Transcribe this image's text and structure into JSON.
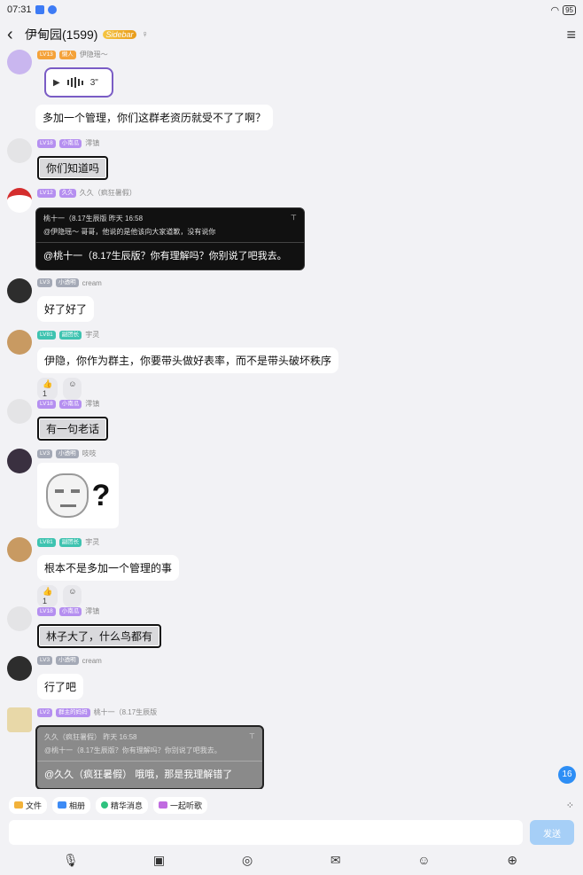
{
  "status": {
    "time": "07:31",
    "battery": "95"
  },
  "nav": {
    "title": "伊甸园(1599)",
    "badge": "Sidebar"
  },
  "messages": {
    "m1": {
      "lv": "LV13",
      "title": "懒人",
      "name": "伊隐瑶～",
      "duration": "3\"",
      "text": "多加一个管理，你们这群老资历就受不了了啊？"
    },
    "m2": {
      "lv": "LV18",
      "title": "小南瓜",
      "name": "澪镇",
      "text": "你们知道吗"
    },
    "m3": {
      "lv": "LV12",
      "title": "久久",
      "name": "久久（疯狂暑假）",
      "quote_head": "桃十一（8.17生辰版 昨天 16:58",
      "quote_text": "@伊隐瑶～ 哥哥，他说的是他该向大家道歉，没有说你",
      "text": "@桃十一（8.17生辰版？你有理解吗？你别说了吧我去。"
    },
    "m4": {
      "lv": "LV3",
      "title": "小透明",
      "name": "cream",
      "text": "好了好了"
    },
    "m5": {
      "lv": "LV81",
      "title": "副团长",
      "name": "宇灵",
      "text": "伊隐，你作为群主，你要带头做好表率，而不是带头破坏秩序",
      "likes": "1"
    },
    "m6": {
      "lv": "LV18",
      "title": "小南瓜",
      "name": "澪镇",
      "text": "有一句老话"
    },
    "m7": {
      "lv": "LV3",
      "title": "小透明",
      "name": "吱吱"
    },
    "m8": {
      "lv": "LV81",
      "title": "副团长",
      "name": "宇灵",
      "text": "根本不是多加一个管理的事",
      "likes": "1"
    },
    "m9": {
      "lv": "LV18",
      "title": "小南瓜",
      "name": "澪镇",
      "text": "林子大了，什么鸟都有"
    },
    "m10": {
      "lv": "LV3",
      "title": "小透明",
      "name": "cream",
      "text": "行了吧"
    },
    "m11": {
      "lv": "LV2",
      "title": "群主的妈妈",
      "name": "桃十一（8.17生辰版",
      "quote_head": "久久（疯狂暑假） 昨天 16:58",
      "quote_text": "@桃十一（8.17生辰版？你有理解吗？你别说了吧我去。",
      "text": "@久久（疯狂暑假） 哦哦，那是我理解错了"
    }
  },
  "unread": "16",
  "quick": {
    "file": "文件",
    "album": "相册",
    "essence": "精华消息",
    "listen": "一起听歌"
  },
  "input": {
    "placeholder": "",
    "send": "发送"
  }
}
